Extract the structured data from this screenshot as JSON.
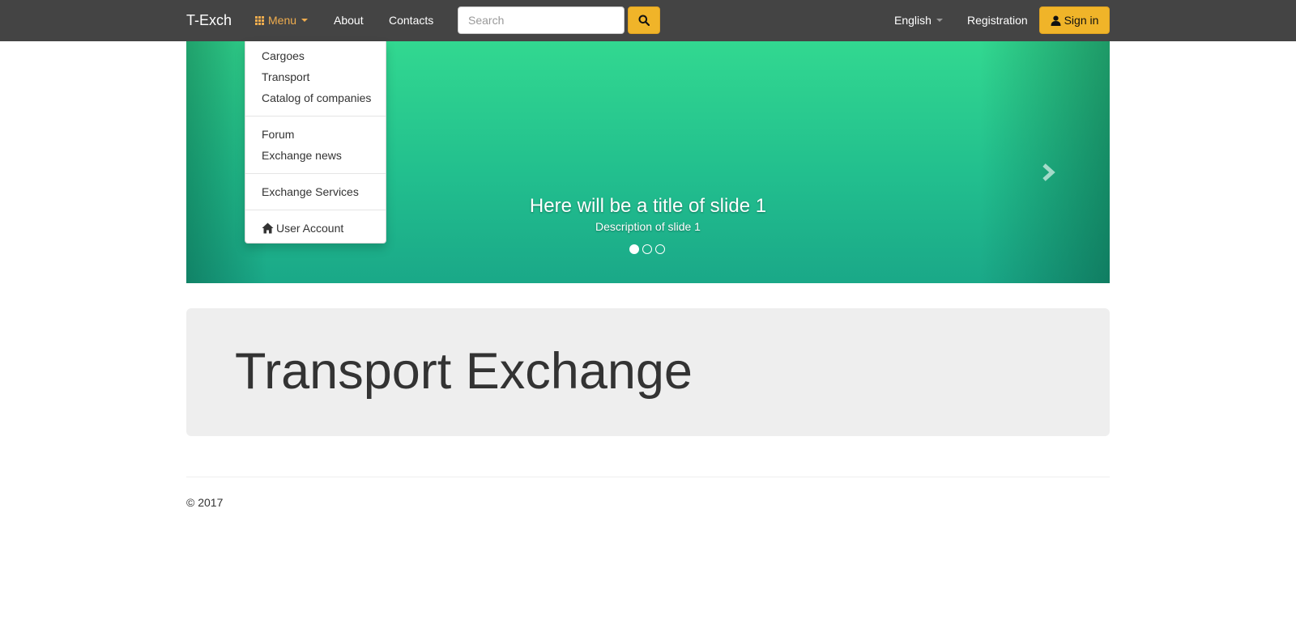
{
  "navbar": {
    "brand": "T-Exch",
    "menu_label": "Menu",
    "about_label": "About",
    "contacts_label": "Contacts",
    "search_placeholder": "Search",
    "language_label": "English",
    "registration_label": "Registration",
    "signin_label": "Sign in"
  },
  "dropdown": {
    "items": [
      "Cargoes",
      "Transport",
      "Catalog of companies",
      "Forum",
      "Exchange news",
      "Exchange Services",
      "User Account"
    ]
  },
  "carousel": {
    "title": "Here will be a title of slide 1",
    "description": "Description of slide 1",
    "slide_count": 3,
    "active_slide": 1
  },
  "jumbotron": {
    "title": "Transport Exchange"
  },
  "footer": {
    "copyright": "© 2017"
  },
  "colors": {
    "navbar_bg": "#444444",
    "accent": "#f0b429",
    "menu_active": "#f0ad4e",
    "carousel_green": "#2ed090",
    "jumbotron_bg": "#eeeeee"
  },
  "icons": {
    "menu": "grid-icon",
    "search": "search-icon",
    "signin": "user-icon",
    "next": "chevron-right-icon",
    "account": "home-icon"
  }
}
